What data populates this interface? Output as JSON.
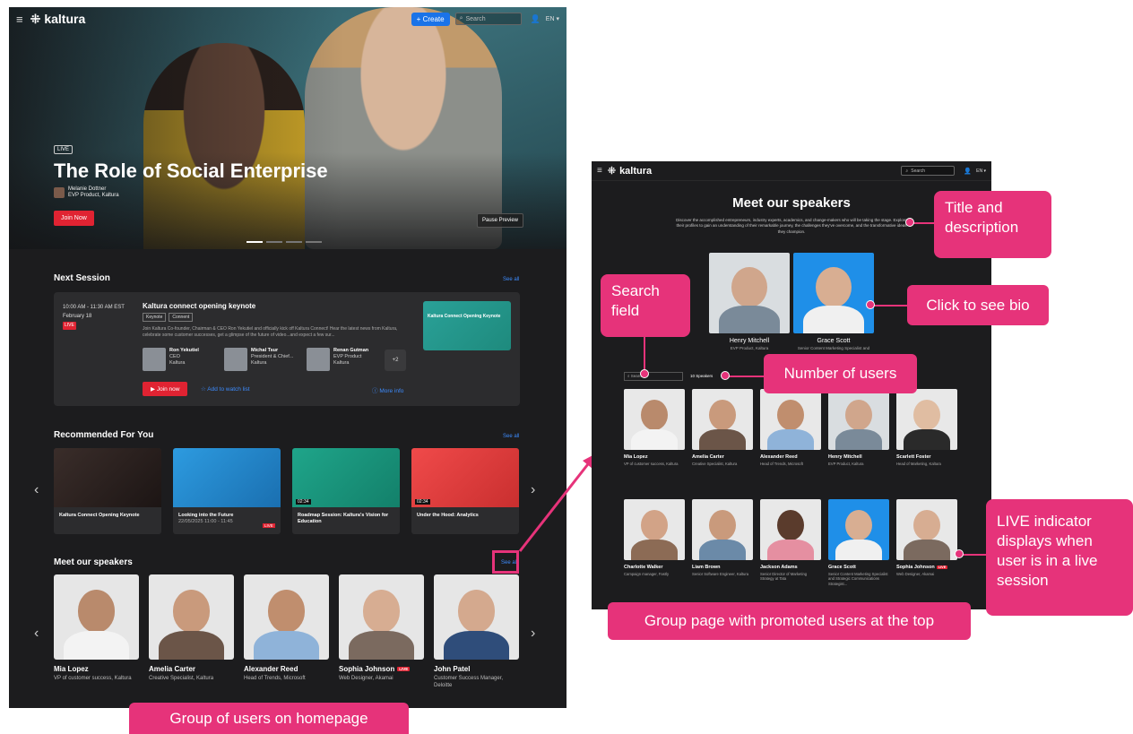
{
  "home": {
    "app_name": "kaltura",
    "create_label": "Create",
    "search_placeholder": "Search",
    "language": "EN",
    "hero": {
      "badge": "LIVE",
      "title": "The Role of Social Enterprise",
      "presenter_name": "Melanie Dottner",
      "presenter_role": "EVP Product, Kaltura",
      "join_label": "Join Now",
      "pause_label": "Pause Preview"
    },
    "next_session": {
      "heading": "Next Session",
      "see_all": "See all",
      "time": "10:00 AM - 11:30 AM EST",
      "date": "February 18",
      "live": "LIVE",
      "title": "Kaltura connect opening keynote",
      "tags": [
        "Keynote",
        "Connent"
      ],
      "description": "Join Kaltura Co-founder, Chairman & CEO Ron Yekutiel and officially kick off Kaltura Connect! Hear the latest news from Kaltura, celebrate some customer successes, get a glimpse of the future of video...and expect a few sur...",
      "speakers": [
        {
          "name": "Ron Yekutiel",
          "role": "CEO",
          "org": "Kaltura"
        },
        {
          "name": "Michal Tsur",
          "role": "President & Chief...",
          "org": "Kaltura"
        },
        {
          "name": "Renan Gutman",
          "role": "EVP Product",
          "org": "Kaltura"
        }
      ],
      "more_count": "+2",
      "thumb_title": "Kaltura Connect Opening Keynote",
      "join_label": "Join now",
      "watch_label": "Add to watch list",
      "more_label": "More info"
    },
    "recommended": {
      "heading": "Recommended For You",
      "see_all": "See all",
      "items": [
        {
          "title": "Kaltura Connect Opening Keynote",
          "date": "",
          "duration": "",
          "live": ""
        },
        {
          "title": "Looking into the Future",
          "date": "22/05/2025 11:00 - 11:45",
          "duration": "",
          "live": "LIVE"
        },
        {
          "title": "Roadmap Session: Kaltura's Vision for Education",
          "date": "",
          "duration": "02:34",
          "live": ""
        },
        {
          "title": "Under the Hood: Analytics",
          "date": "",
          "duration": "02:34",
          "live": ""
        }
      ]
    },
    "speakers": {
      "heading": "Meet our speakers",
      "see_all": "See all",
      "items": [
        {
          "name": "Mia Lopez",
          "role": "VP of customer success, Kaltura",
          "live": ""
        },
        {
          "name": "Amelia Carter",
          "role": "Creative Specialist, Kaltura",
          "live": ""
        },
        {
          "name": "Alexander Reed",
          "role": "Head of Trends, Microsoft",
          "live": ""
        },
        {
          "name": "Sophia Johnson",
          "role": "Web Designer, Akamai",
          "live": "LIVE"
        },
        {
          "name": "John Patel",
          "role": "Customer Success Manager, Deloitte",
          "live": ""
        }
      ]
    }
  },
  "group": {
    "app_name": "kaltura",
    "search_placeholder": "Search",
    "language": "EN",
    "title": "Meet our speakers",
    "description": "Discover the accomplished entrepreneurs, industry experts, academics, and change-makers who will be taking the stage. Explore their profiles to gain an understanding of their remarkable journey, the challenges they've overcome, and the transformative ideas they champion.",
    "promoted": [
      {
        "name": "Henry Mitchell",
        "role": "EVP Product, Kaltura"
      },
      {
        "name": "Grace Scott",
        "role": "Senior Content Marketing Specialist and"
      }
    ],
    "search_placeholder_list": "Search",
    "count": "10 Speakers",
    "users": [
      {
        "name": "Mia Lopez",
        "role": "VP of customer success, Kaltura",
        "live": ""
      },
      {
        "name": "Amelia Carter",
        "role": "Creative Specialist, Kaltura",
        "live": ""
      },
      {
        "name": "Alexander Reed",
        "role": "Head of Trends, Microsoft",
        "live": ""
      },
      {
        "name": "Henry Mitchell",
        "role": "EVP Product, Kaltura",
        "live": ""
      },
      {
        "name": "Scarlett Foster",
        "role": "Head of Marketing, Kaltura",
        "live": ""
      },
      {
        "name": "Charlotte Walker",
        "role": "Campaign manager, Fastly",
        "live": ""
      },
      {
        "name": "Liam Brown",
        "role": "Senior Software Engineer, Kaltura",
        "live": ""
      },
      {
        "name": "Jackson Adams",
        "role": "Senior Director of Marketing Strategy at Tata",
        "live": ""
      },
      {
        "name": "Grace Scott",
        "role": "Senior Content Marketing Specialist and Strategic Communications Strategist...",
        "live": ""
      },
      {
        "name": "Sophia Johnson",
        "role": "Web Designer, Akamai",
        "live": "LIVE"
      }
    ]
  },
  "callouts": {
    "title_desc": "Title and description",
    "click_bio": "Click to see bio",
    "search_field": "Search field",
    "number_users": "Number of users",
    "live_indicator": "LIVE indicator displays when user is in a live session",
    "group_page": "Group page with promoted users at the top",
    "homepage_group": "Group of users on homepage"
  },
  "colors": {
    "accent_pink": "#e6337a",
    "live_red": "#e02332",
    "link_blue": "#3d8bfd",
    "dark_bg": "#1c1c1e"
  }
}
